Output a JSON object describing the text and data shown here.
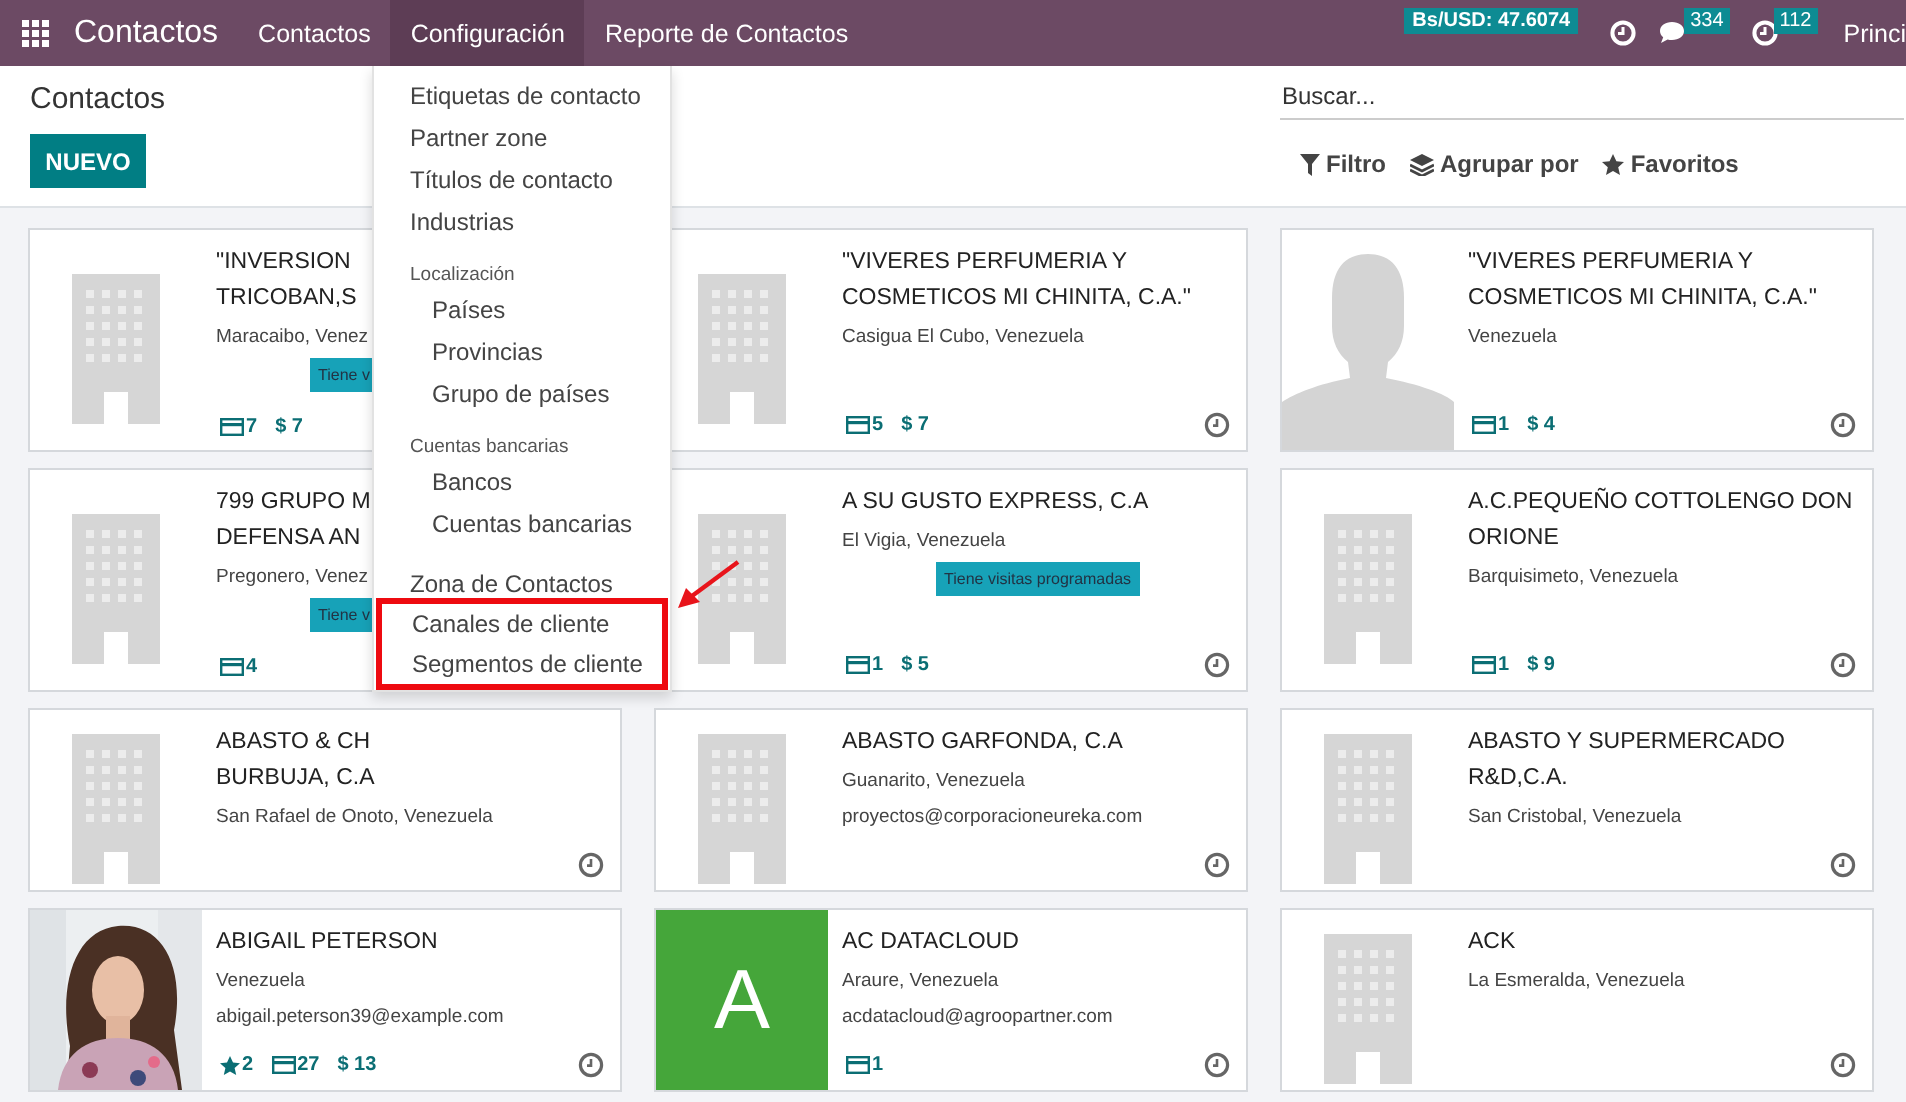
{
  "navbar": {
    "app_name": "Contactos",
    "menu": [
      {
        "label": "Contactos",
        "selected": false
      },
      {
        "label": "Configuración",
        "selected": true
      },
      {
        "label": "Reporte de Contactos",
        "selected": false
      }
    ],
    "rate_badge": "Bs/USD: 47.6074",
    "messages_count": "334",
    "activities_count": "112",
    "company": "Princi"
  },
  "control_panel": {
    "title": "Contactos",
    "new_button": "NUEVO",
    "search_placeholder": "Buscar...",
    "filters": [
      {
        "kind": "filter",
        "label": "Filtro"
      },
      {
        "kind": "group",
        "label": "Agrupar por"
      },
      {
        "kind": "favorites",
        "label": "Favoritos"
      }
    ]
  },
  "config_menu": {
    "items": [
      {
        "kind": "item",
        "label": "Etiquetas de contacto",
        "highlighted": false
      },
      {
        "kind": "item",
        "label": "Partner zone",
        "highlighted": false
      },
      {
        "kind": "item",
        "label": "Títulos de contacto",
        "highlighted": false
      },
      {
        "kind": "item",
        "label": "Industrias",
        "highlighted": false
      },
      {
        "kind": "header",
        "label": "Localización",
        "highlighted": false
      },
      {
        "kind": "subitem",
        "label": "Países",
        "highlighted": false
      },
      {
        "kind": "subitem",
        "label": "Provincias",
        "highlighted": false
      },
      {
        "kind": "subitem",
        "label": "Grupo de países",
        "highlighted": false
      },
      {
        "kind": "header",
        "label": "Cuentas bancarias",
        "highlighted": false
      },
      {
        "kind": "subitem",
        "label": "Bancos",
        "highlighted": false
      },
      {
        "kind": "subitem",
        "label": "Cuentas bancarias",
        "highlighted": false
      },
      {
        "kind": "item",
        "label": "Zona de Contactos",
        "highlighted": false
      },
      {
        "kind": "item",
        "label": "Canales de cliente",
        "highlighted": true
      },
      {
        "kind": "item",
        "label": "Segmentos de cliente",
        "highlighted": true
      }
    ]
  },
  "cards": [
    {
      "name_lines": [
        "\"INVERSION",
        "TRICOBAN,S"
      ],
      "location": "Maracaibo, Venez",
      "tag": "Tiene v",
      "image": {
        "kind": "building"
      },
      "stats": [
        {
          "kind": "cards",
          "value": "7"
        },
        {
          "kind": "money",
          "value": "$ 7"
        }
      ],
      "activity": false
    },
    {
      "name_lines": [
        "\"VIVERES PERFUMERIA Y",
        "COSMETICOS MI CHINITA, C.A.\""
      ],
      "location": "Casigua El Cubo, Venezuela",
      "image": {
        "kind": "building"
      },
      "stats": [
        {
          "kind": "cards",
          "value": "5"
        },
        {
          "kind": "money",
          "value": "$ 7"
        }
      ],
      "activity": true
    },
    {
      "name_lines": [
        "\"VIVERES PERFUMERIA Y",
        "COSMETICOS MI CHINITA, C.A.\""
      ],
      "location": "Venezuela",
      "image": {
        "kind": "person"
      },
      "stats": [
        {
          "kind": "cards",
          "value": "1"
        },
        {
          "kind": "money",
          "value": "$ 4"
        }
      ],
      "activity": true
    },
    {
      "name_lines": [
        "799 GRUPO M",
        "DEFENSA AN"
      ],
      "location": "Pregonero, Venez",
      "tag": "Tiene v",
      "image": {
        "kind": "building"
      },
      "stats": [
        {
          "kind": "cards",
          "value": "4"
        }
      ],
      "activity": false
    },
    {
      "name_lines": [
        "A SU GUSTO EXPRESS, C.A"
      ],
      "location": "El Vigia, Venezuela",
      "tag": "Tiene visitas programadas",
      "image": {
        "kind": "building"
      },
      "stats": [
        {
          "kind": "cards",
          "value": "1"
        },
        {
          "kind": "money",
          "value": "$ 5"
        }
      ],
      "activity": true
    },
    {
      "name_lines": [
        "A.C.PEQUEÑO COTTOLENGO DON",
        "ORIONE"
      ],
      "location": "Barquisimeto, Venezuela",
      "image": {
        "kind": "building"
      },
      "stats": [
        {
          "kind": "cards",
          "value": "1"
        },
        {
          "kind": "money",
          "value": "$ 9"
        }
      ],
      "activity": true
    },
    {
      "name_lines": [
        "ABASTO & CH",
        "BURBUJA, C.A"
      ],
      "location": "San Rafael de Onoto, Venezuela",
      "image": {
        "kind": "building"
      },
      "activity": true
    },
    {
      "name_lines": [
        "ABASTO GARFONDA, C.A"
      ],
      "location": "Guanarito, Venezuela",
      "email": "proyectos@corporacioneureka.com",
      "image": {
        "kind": "building"
      },
      "activity": true
    },
    {
      "name_lines": [
        "ABASTO Y SUPERMERCADO",
        "R&D,C.A."
      ],
      "location": "San Cristobal, Venezuela",
      "image": {
        "kind": "building"
      },
      "activity": true
    },
    {
      "name_lines": [
        "ABIGAIL PETERSON"
      ],
      "location": "Venezuela",
      "email": "abigail.peterson39@example.com",
      "image": {
        "kind": "picture"
      },
      "stats": [
        {
          "kind": "stars",
          "value": "2"
        },
        {
          "kind": "cards",
          "value": "27"
        },
        {
          "kind": "money",
          "value": "$ 13"
        }
      ],
      "activity": true
    },
    {
      "name_lines": [
        "AC DATACLOUD"
      ],
      "location": "Araure, Venezuela",
      "email": "acdatacloud@agroopartner.com",
      "image": {
        "kind": "letter",
        "letter": "A"
      },
      "stats": [
        {
          "kind": "cards",
          "value": "1"
        }
      ],
      "activity": true
    },
    {
      "name_lines": [
        "ACK"
      ],
      "location": "La Esmeralda, Venezuela",
      "image": {
        "kind": "building"
      },
      "activity": true
    }
  ]
}
